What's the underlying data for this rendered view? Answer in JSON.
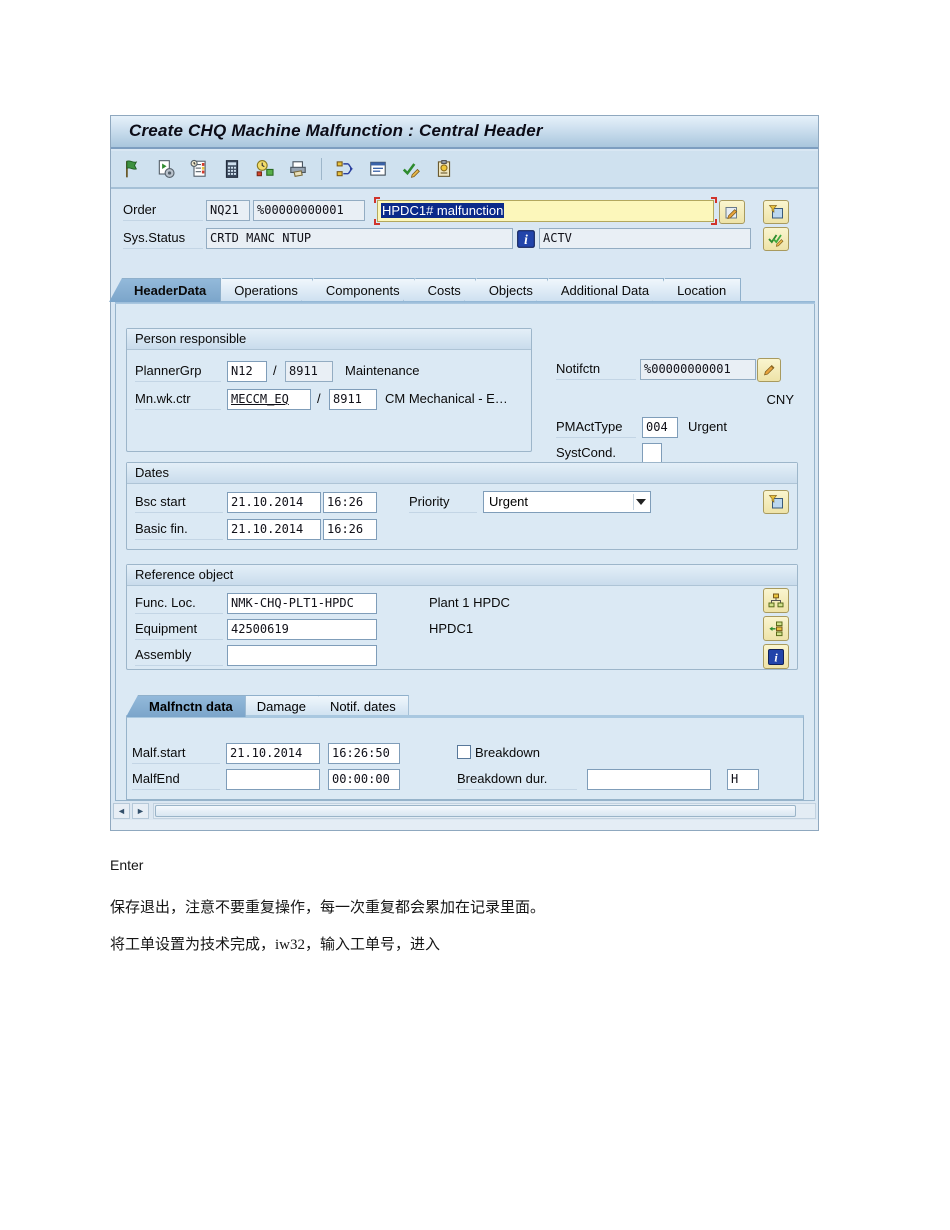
{
  "window": {
    "title": "Create CHQ Machine Malfunction : Central Header",
    "order": {
      "label": "Order",
      "type": "NQ21",
      "number": "%00000000001",
      "text": "HPDC1# malfunction"
    },
    "status": {
      "label": "Sys.Status",
      "system": "CRTD MANC NTUP",
      "user": "ACTV"
    },
    "tabs": [
      {
        "label": "HeaderData"
      },
      {
        "label": "Operations"
      },
      {
        "label": "Components"
      },
      {
        "label": "Costs"
      },
      {
        "label": "Objects"
      },
      {
        "label": "Additional Data"
      },
      {
        "label": "Location"
      }
    ],
    "person_responsible": {
      "title": "Person responsible",
      "planner_grp": {
        "label": "PlannerGrp",
        "value": "N12",
        "slash": "/",
        "plant": "8911",
        "desc": "Maintenance"
      },
      "work_ctr": {
        "label": "Mn.wk.ctr",
        "value": "MECCM_EQ",
        "slash": "/",
        "plant": "8911",
        "desc": "CM Mechanical - E…"
      }
    },
    "notification": {
      "label": "Notifctn",
      "value": "%00000000001",
      "currency": "CNY",
      "pmacttype_label": "PMActType",
      "pmacttype": "004",
      "pmacttype_desc": "Urgent",
      "systcond_label": "SystCond.",
      "systcond": ""
    },
    "dates": {
      "title": "Dates",
      "bsc_start": {
        "label": "Bsc start",
        "date": "21.10.2014",
        "time": "16:26"
      },
      "basic_fin": {
        "label": "Basic fin.",
        "date": "21.10.2014",
        "time": "16:26"
      },
      "priority": {
        "label": "Priority",
        "value": "Urgent"
      }
    },
    "reference": {
      "title": "Reference object",
      "func_loc": {
        "label": "Func. Loc.",
        "value": "NMK-CHQ-PLT1-HPDC",
        "desc": "Plant 1 HPDC"
      },
      "equipment": {
        "label": "Equipment",
        "value": "42500619",
        "desc": "HPDC1"
      },
      "assembly": {
        "label": "Assembly",
        "value": ""
      }
    },
    "malfunction": {
      "tabs": [
        {
          "label": "Malfnctn data"
        },
        {
          "label": "Damage"
        },
        {
          "label": "Notif. dates"
        }
      ],
      "malf_start": {
        "label": "Malf.start",
        "date": "21.10.2014",
        "time": "16:26:50"
      },
      "malf_end": {
        "label": "MalfEnd",
        "date": "",
        "time": "00:00:00"
      },
      "breakdown_label": "Breakdown",
      "breakdown_dur_label": "Breakdown dur.",
      "breakdown_dur": "",
      "unit": "H"
    }
  },
  "document": {
    "line1": "Enter",
    "line2": "保存退出，注意不要重复操作，每一次重复都会累加在记录里面。",
    "line3": "将工单设置为技术完成，iw32，输入工单号，进入"
  }
}
